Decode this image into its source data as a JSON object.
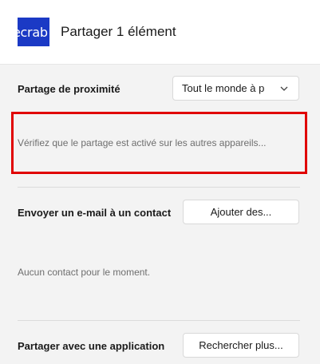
{
  "header": {
    "logo_text": "ecrab",
    "title": "Partager 1 élément"
  },
  "nearby": {
    "label": "Partage de proximité",
    "select_value": "Tout le monde à p",
    "hint": "Vérifiez que le partage est activé sur les autres appareils..."
  },
  "email": {
    "label": "Envoyer un e-mail à un contact",
    "button": "Ajouter des...",
    "empty_text": "Aucun contact pour le moment."
  },
  "apps": {
    "label": "Partager avec une application",
    "button": "Rechercher plus..."
  },
  "colors": {
    "logo_bg": "#1b3ac5",
    "highlight": "#e00000",
    "panel_bg": "#f3f3f3"
  }
}
